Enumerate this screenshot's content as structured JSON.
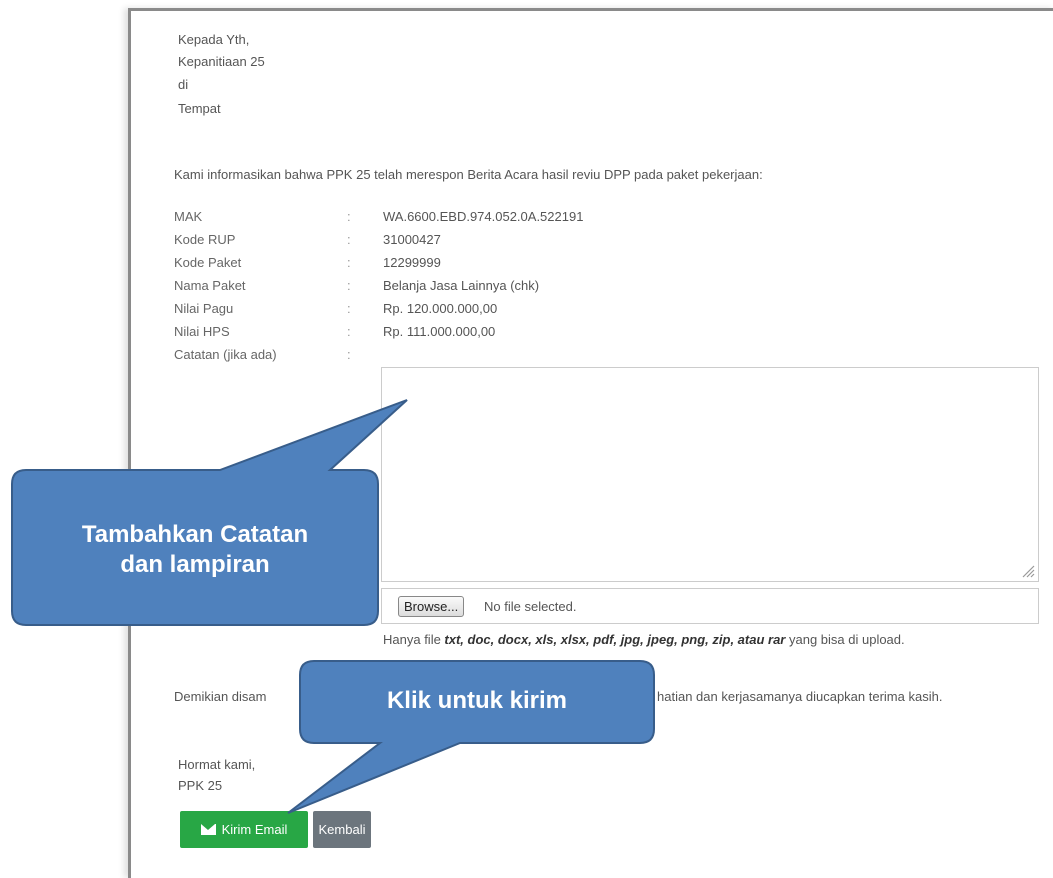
{
  "letter": {
    "salutation": [
      "Kepada Yth,",
      "Kepanitiaan 25",
      "di",
      "Tempat"
    ],
    "intro": "Kami informasikan bahwa PPK 25 telah merespon Berita Acara hasil reviu DPP pada paket pekerjaan:",
    "fields": [
      {
        "label": "MAK",
        "value": "WA.6600.EBD.974.052.0A.522191"
      },
      {
        "label": "Kode RUP",
        "value": "31000427"
      },
      {
        "label": "Kode Paket",
        "value": "12299999"
      },
      {
        "label": "Nama Paket",
        "value": "Belanja Jasa Lainnya (chk)"
      },
      {
        "label": "Nilai Pagu",
        "value": "Rp. 120.000.000,00"
      },
      {
        "label": "Nilai HPS",
        "value": "Rp. 111.000.000,00"
      },
      {
        "label": "Catatan (jika ada)",
        "value": ""
      }
    ],
    "colon": ":",
    "closing_left": "Demikian disam",
    "closing_right": "hatian dan kerjasamanya diucapkan terima kasih.",
    "signoff": [
      "Hormat kami,",
      "PPK 25"
    ]
  },
  "upload": {
    "browse_label": "Browse...",
    "no_file": "No file selected.",
    "hint_prefix": "Hanya file ",
    "hint_types": "txt, doc, docx, xls, xlsx, pdf, jpg, jpeg, png, zip, atau rar",
    "hint_suffix": " yang bisa di upload."
  },
  "buttons": {
    "send_label": "Kirim Email",
    "back_label": "Kembali",
    "send_color": "#28a745",
    "back_color": "#6c757d"
  },
  "callouts": {
    "notes": [
      "Tambahkan Catatan",
      "dan lampiran"
    ],
    "send": "Klik untuk kirim",
    "fill": "#4f81bd",
    "stroke": "#385d8a"
  },
  "icons": {
    "send": "envelope-icon",
    "resize": "resize-handle-icon"
  }
}
